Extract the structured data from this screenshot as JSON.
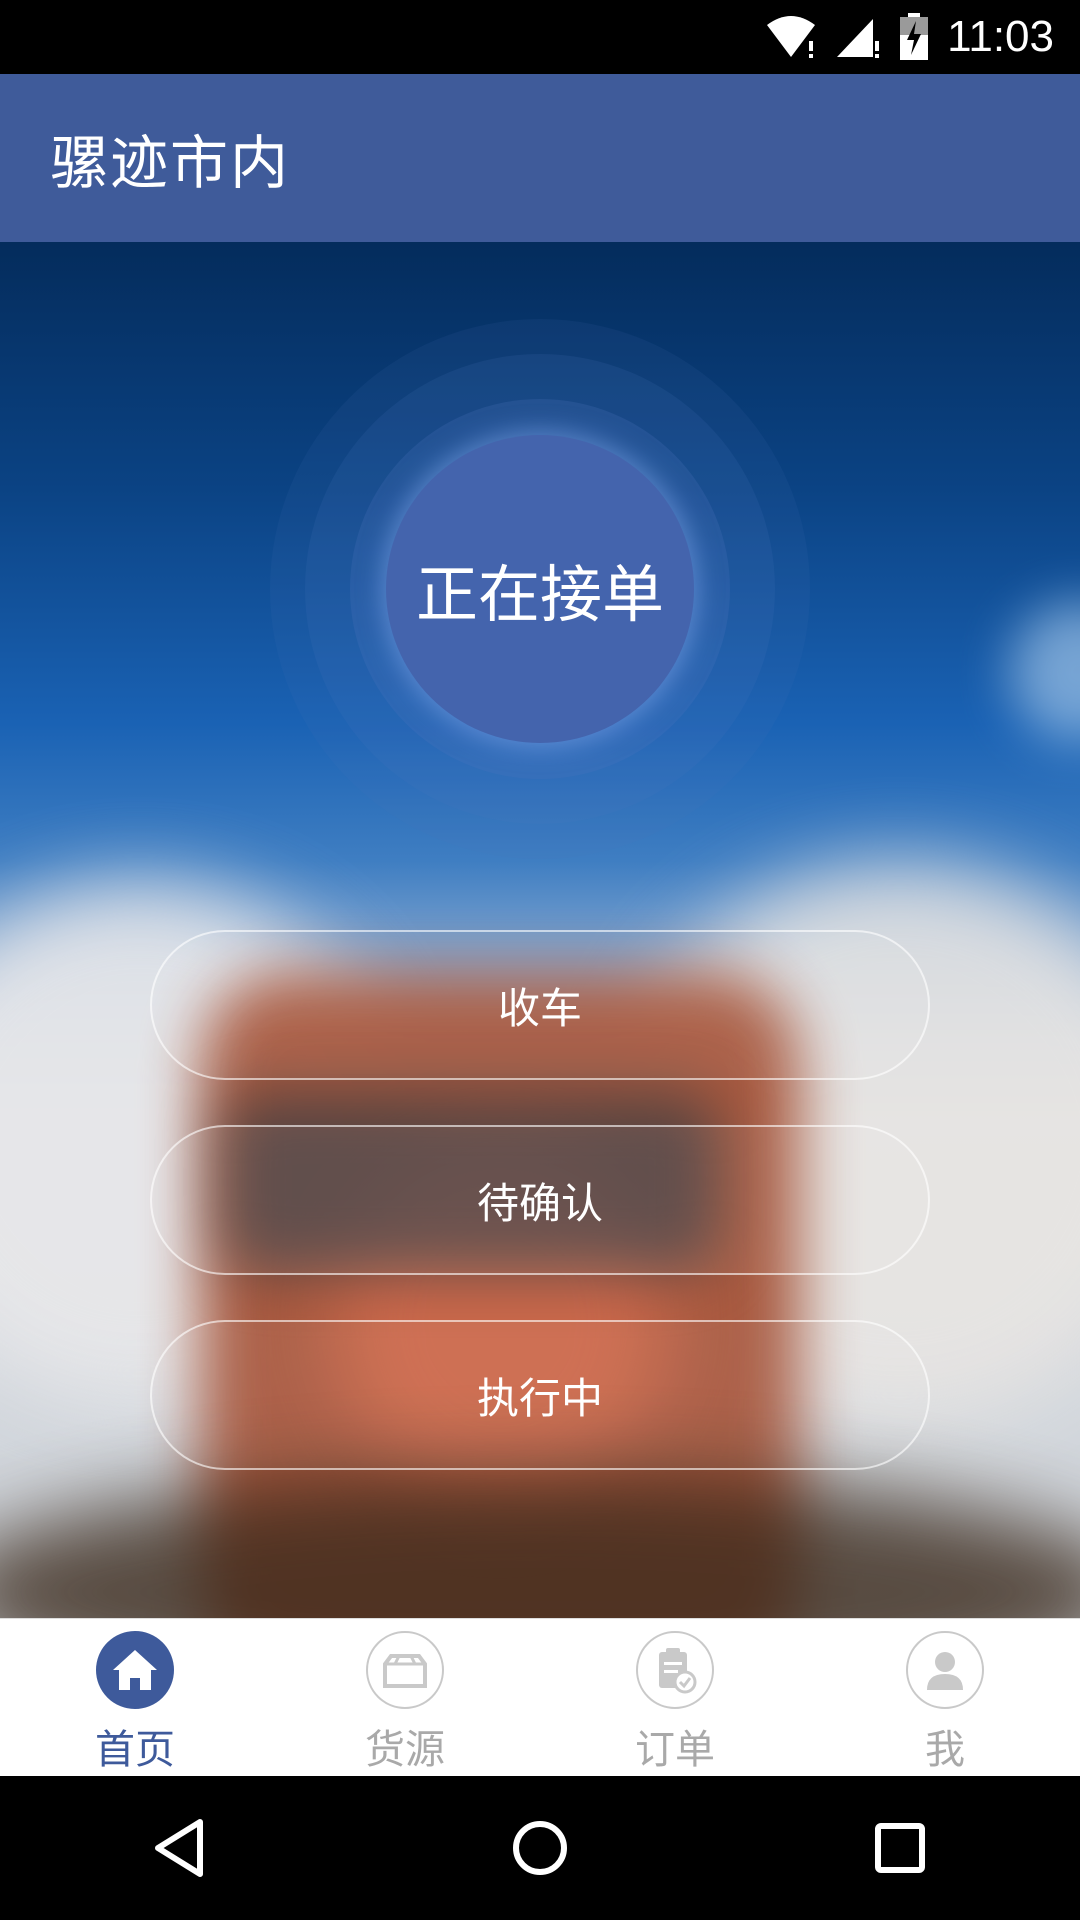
{
  "status_bar": {
    "time": "11:03",
    "icons": [
      "wifi-icon",
      "signal-icon",
      "battery-charging-icon"
    ]
  },
  "app_bar": {
    "title": "骡迹市内"
  },
  "main": {
    "receive_button_label": "正在接单",
    "actions": [
      {
        "label": "收车"
      },
      {
        "label": "待确认"
      },
      {
        "label": "执行中"
      }
    ]
  },
  "tab_bar": {
    "tabs": [
      {
        "label": "首页",
        "icon": "home-icon",
        "active": true
      },
      {
        "label": "货源",
        "icon": "box-icon",
        "active": false
      },
      {
        "label": "订单",
        "icon": "clipboard-check-icon",
        "active": false
      },
      {
        "label": "我",
        "icon": "user-icon",
        "active": false
      }
    ]
  },
  "nav_bar": {
    "buttons": [
      "back-icon",
      "home-circle-icon",
      "recents-icon"
    ]
  },
  "colors": {
    "app_bar": "#3f5b9a",
    "accent": "#3e5a9b",
    "inactive": "#a9a9a9"
  }
}
